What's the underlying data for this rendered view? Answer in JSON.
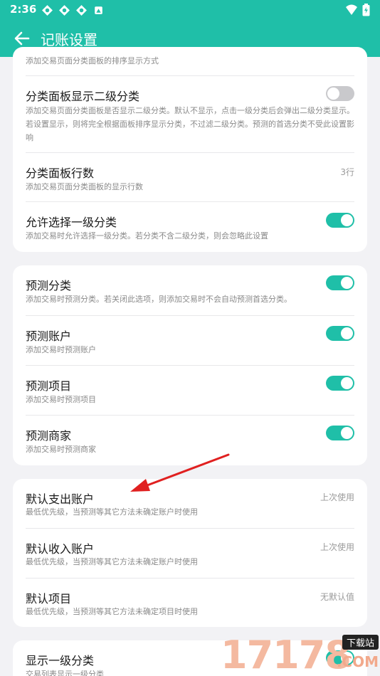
{
  "status_bar": {
    "time": "2:36"
  },
  "app_bar": {
    "title": "记账设置"
  },
  "section1": {
    "partial_desc": "添加交易页面分类面板的排序显示方式",
    "items": [
      {
        "title": "分类面板显示二级分类",
        "desc": "添加交易页面分类面板是否显示二级分类。默认不显示，点击一级分类后会弹出二级分类显示。若设置显示，则将完全根据面板排序显示分类，不过滤二级分类。预测的首选分类不受此设置影响",
        "toggle": "off"
      },
      {
        "title": "分类面板行数",
        "desc": "添加交易页面分类面板的显示行数",
        "value": "3行"
      },
      {
        "title": "允许选择一级分类",
        "desc": "添加交易时允许选择一级分类。若分类不含二级分类，则会忽略此设置",
        "toggle": "on"
      }
    ]
  },
  "section2": {
    "items": [
      {
        "title": "预测分类",
        "desc": "添加交易时预测分类。若关闭此选项，则添加交易时不会自动预测首选分类。",
        "toggle": "on"
      },
      {
        "title": "预测账户",
        "desc": "添加交易时预测账户",
        "toggle": "on"
      },
      {
        "title": "预测项目",
        "desc": "添加交易时预测项目",
        "toggle": "on"
      },
      {
        "title": "预测商家",
        "desc": "添加交易时预测商家",
        "toggle": "on"
      }
    ]
  },
  "section3": {
    "items": [
      {
        "title": "默认支出账户",
        "desc": "最低优先级，当预测等其它方法未确定账户时使用",
        "value": "上次使用"
      },
      {
        "title": "默认收入账户",
        "desc": "最低优先级，当预测等其它方法未确定账户时使用",
        "value": "上次使用"
      },
      {
        "title": "默认项目",
        "desc": "最低优先级，当预测等其它方法未确定项目时使用",
        "value": "无默认值"
      }
    ]
  },
  "section4": {
    "items": [
      {
        "title": "显示一级分类",
        "desc": "交易列表显示一级分类",
        "toggle": "on"
      }
    ]
  },
  "watermark": {
    "digits": "17178",
    "badge": "下载站",
    "domain": ".COM"
  },
  "colors": {
    "accent": "#1fbfa8",
    "background": "#f2f2f5",
    "card": "#ffffff",
    "arrow": "#e02020"
  }
}
